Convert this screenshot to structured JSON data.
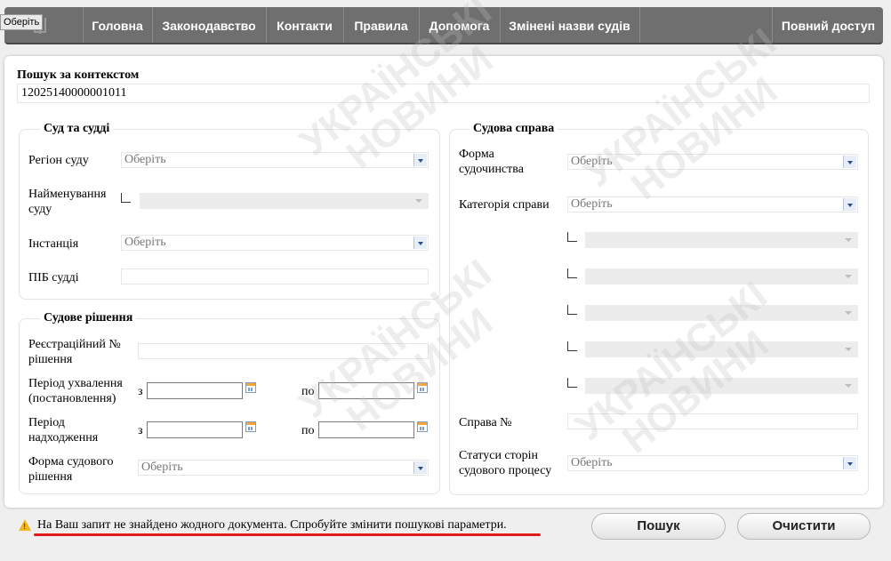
{
  "nav": {
    "tooltip": "Оберіть",
    "items": [
      "Головна",
      "Законодавство",
      "Контакти",
      "Правила",
      "Допомога",
      "Змінені назви судів",
      "Повний доступ"
    ]
  },
  "search": {
    "label": "Пошук за контекстом",
    "value": "12025140000001011"
  },
  "court": {
    "legend": "Суд та судді",
    "region_label": "Регіон суду",
    "region_value": "Оберіть",
    "name_label": "Найменування суду",
    "instance_label": "Інстанція",
    "instance_value": "Оберіть",
    "judge_label": "ПІБ судді"
  },
  "decision": {
    "legend": "Судове рішення",
    "reg_label": "Реєстраційний № рішення",
    "period_adopt_label": "Період ухвалення (постановлення)",
    "period_receive_label": "Період надходження",
    "from": "з",
    "to": "по",
    "form_label": "Форма судового рішення",
    "form_value": "Оберіть"
  },
  "case": {
    "legend": "Судова справа",
    "proc_label": "Форма судочинства",
    "proc_value": "Оберіть",
    "category_label": "Категорія справи",
    "category_value": "Оберіть",
    "number_label": "Справа №",
    "status_label": "Статуси сторін судового процесу",
    "status_value": "Оберіть"
  },
  "footer": {
    "message": "На Ваш запит не знайдено жодного документа. Спробуйте змінити пошукові параметри.",
    "search_button": "Пошук",
    "clear_button": "Очистити"
  },
  "watermark": {
    "line1": "УКРАЇНСЬКІ",
    "line2": "НОВИНИ"
  },
  "colors": {
    "nav": "#6f6f6f",
    "warning": "#f2b824",
    "underline": "#e01a1a",
    "select_arrow": "#2a4f8c"
  }
}
